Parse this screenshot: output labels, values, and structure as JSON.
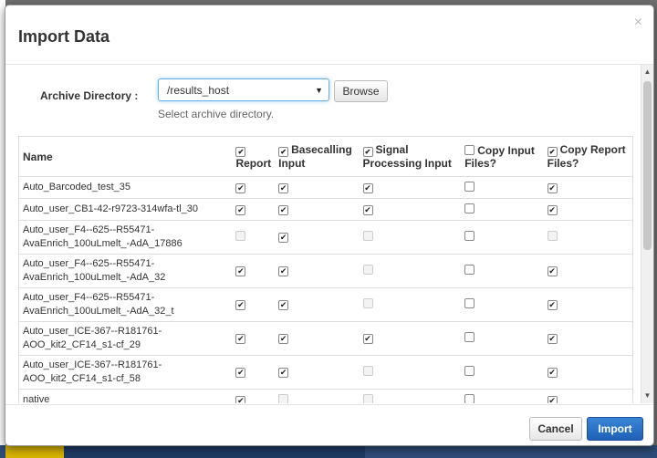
{
  "dialog": {
    "title": "Import Data",
    "close_glyph": "×"
  },
  "archive": {
    "label": "Archive Directory :",
    "value": "/results_host",
    "help": "Select archive directory.",
    "browse_label": "Browse"
  },
  "table": {
    "headers": {
      "name": "Name",
      "report": "Report",
      "basecalling": "Basecalling",
      "basecalling_2": "Input",
      "signal": "Signal",
      "signal_2": "Processing Input",
      "copy_input": "Copy Input",
      "copy_input_2": "Files?",
      "copy_report": "Copy Report",
      "copy_report_2": "Files?"
    },
    "header_checks": {
      "report": true,
      "basecalling": true,
      "signal": true,
      "copy_input": false,
      "copy_report": true
    },
    "rows": [
      {
        "name": "Auto_Barcoded_test_35",
        "report": "on",
        "base": "on",
        "signal": "on",
        "copy_in": "off",
        "copy_rep": "on"
      },
      {
        "name": "Auto_user_CB1-42-r9723-314wfa-tl_30",
        "report": "on",
        "base": "on",
        "signal": "on",
        "copy_in": "off",
        "copy_rep": "on"
      },
      {
        "name": "Auto_user_F4--625--R55471-\nAvaEnrich_100uLmelt_-AdA_17886",
        "report": "disabled",
        "base": "on",
        "signal": "disabled",
        "copy_in": "off",
        "copy_rep": "disabled"
      },
      {
        "name": "Auto_user_F4--625--R55471-\nAvaEnrich_100uLmelt_-AdA_32",
        "report": "on",
        "base": "on",
        "signal": "disabled",
        "copy_in": "off",
        "copy_rep": "on"
      },
      {
        "name": "Auto_user_F4--625--R55471-\nAvaEnrich_100uLmelt_-AdA_32_t",
        "report": "on",
        "base": "on",
        "signal": "disabled",
        "copy_in": "off",
        "copy_rep": "on"
      },
      {
        "name": "Auto_user_ICE-367--R181761-\nAOO_kit2_CF14_s1-cf_29",
        "report": "on",
        "base": "on",
        "signal": "on",
        "copy_in": "off",
        "copy_rep": "on"
      },
      {
        "name": "Auto_user_ICE-367--R181761-\nAOO_kit2_CF14_s1-cf_58",
        "report": "on",
        "base": "on",
        "signal": "disabled",
        "copy_in": "off",
        "copy_rep": "on"
      },
      {
        "name": "native",
        "report": "on",
        "base": "disabled",
        "signal": "disabled",
        "copy_in": "off",
        "copy_rep": "on"
      }
    ]
  },
  "footer": {
    "cancel_label": "Cancel",
    "import_label": "Import"
  }
}
